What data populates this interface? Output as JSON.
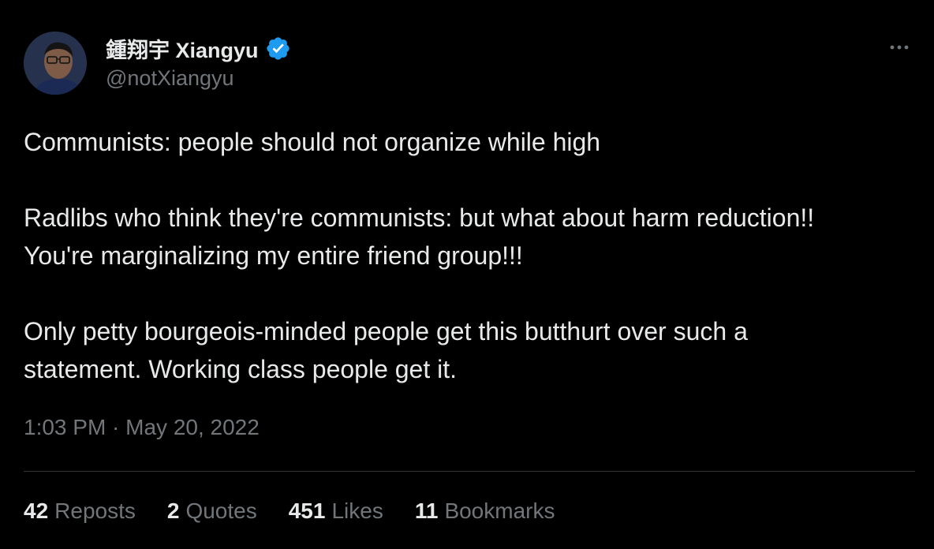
{
  "author": {
    "display_name": "鍾翔宇 Xiangyu",
    "handle": "@notXiangyu",
    "verified": true,
    "verified_color": "#1d9bf0"
  },
  "tweet": {
    "paragraphs": [
      "Communists: people should not organize while high",
      "Radlibs who think they're communists: but what about harm reduction!!\nYou're marginalizing my entire friend group!!!",
      "Only petty bourgeois-minded people get this butthurt over such a\nstatement. Working class people get it."
    ],
    "timestamp": "1:03 PM · May 20, 2022"
  },
  "stats": {
    "reposts": {
      "count": "42",
      "label": "Reposts"
    },
    "quotes": {
      "count": "2",
      "label": "Quotes"
    },
    "likes": {
      "count": "451",
      "label": "Likes"
    },
    "bookmarks": {
      "count": "11",
      "label": "Bookmarks"
    }
  },
  "icons": {
    "more": "more-horizontal-icon",
    "verified": "verified-badge-icon"
  },
  "colors": {
    "background": "#000000",
    "text_primary": "#e7e9ea",
    "text_secondary": "#71767b",
    "divider": "#2f3336"
  }
}
